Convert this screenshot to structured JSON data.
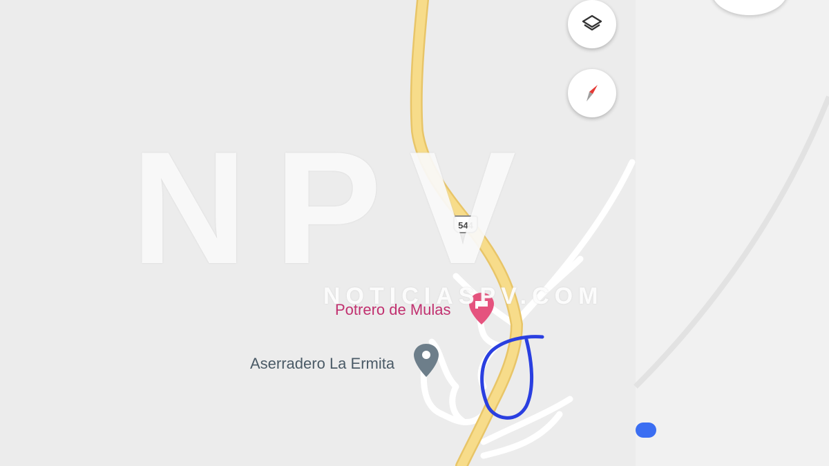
{
  "map": {
    "route_shield": "544",
    "places": [
      {
        "name": "Potrero de Mulas",
        "type": "lodging",
        "color": "#c1306f",
        "icon": "bed-pin-icon"
      },
      {
        "name": "Aserradero La Ermita",
        "type": "place",
        "color": "#687985",
        "icon": "location-pin-icon"
      }
    ],
    "road_color": "#f7dc8a",
    "annotation_color": "#2a3fe0"
  },
  "controls": {
    "layers_icon": "layers-icon",
    "compass_icon": "compass-icon"
  },
  "watermark": {
    "logo": "NPV",
    "url": "NOTICIASPV.COM"
  }
}
